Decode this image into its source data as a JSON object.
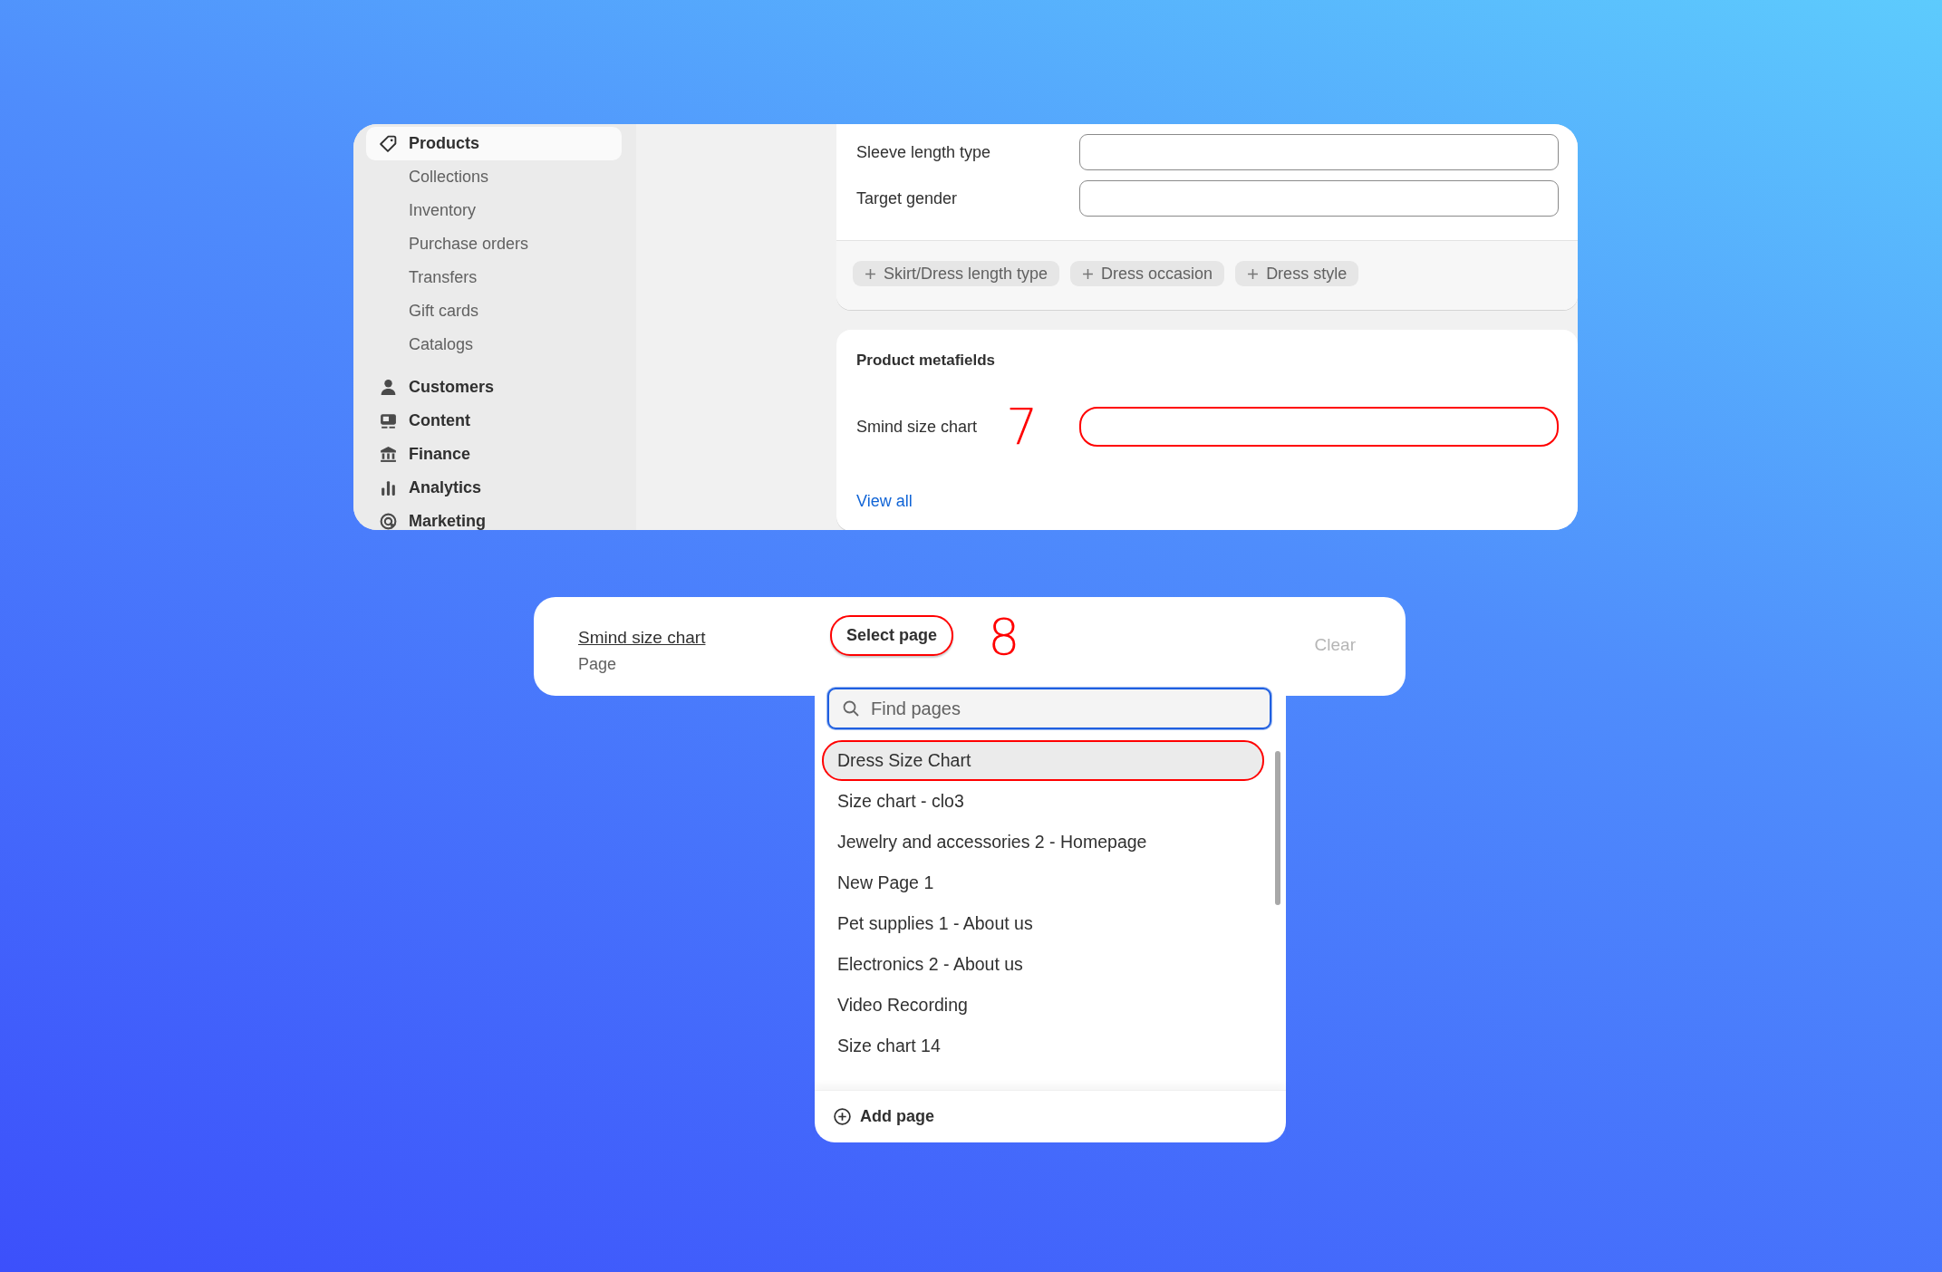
{
  "sidebar": {
    "items": [
      {
        "label": "Products",
        "selected": true,
        "children": [
          {
            "label": "Collections",
            "selected": false
          },
          {
            "label": "Inventory",
            "selected": false
          },
          {
            "label": "Purchase orders",
            "selected": false
          },
          {
            "label": "Transfers",
            "selected": false
          },
          {
            "label": "Gift cards",
            "selected": false
          },
          {
            "label": "Catalogs",
            "selected": false
          }
        ]
      },
      {
        "label": "Customers",
        "selected": false
      },
      {
        "label": "Content",
        "selected": false
      },
      {
        "label": "Finance",
        "selected": false
      },
      {
        "label": "Analytics",
        "selected": false
      },
      {
        "label": "Marketing",
        "selected": false
      }
    ]
  },
  "attributes_card": {
    "fields": [
      {
        "label": "Sleeve length type"
      },
      {
        "label": "Target gender"
      }
    ],
    "add_buttons": [
      "Skirt/Dress length type",
      "Dress occasion",
      "Dress style"
    ]
  },
  "metafields_card": {
    "title": "Product metafields",
    "fields": [
      {
        "label": "Smind size chart",
        "annotation": "7",
        "highlighted": true
      }
    ],
    "link": "View all"
  },
  "page_picker": {
    "name": "Smind size chart",
    "type": "Page",
    "button": "Select page",
    "button_highlighted": true,
    "annotation": "8",
    "clear": "Clear",
    "dropdown": {
      "search": {
        "placeholder": "Find pages"
      },
      "items": [
        {
          "label": "Dress Size Chart",
          "selected": true,
          "highlighted": true
        },
        {
          "label": "Size chart - clo3",
          "selected": false,
          "highlighted": false
        },
        {
          "label": "Jewelry and accessories 2 - Homepage",
          "selected": false,
          "highlighted": false
        },
        {
          "label": "New Page 1",
          "selected": false,
          "highlighted": false
        },
        {
          "label": "Pet supplies 1 - About us",
          "selected": false,
          "highlighted": false
        },
        {
          "label": "Electronics 2 - About us",
          "selected": false,
          "highlighted": false
        },
        {
          "label": "Video Recording",
          "selected": false,
          "highlighted": false
        },
        {
          "label": "Size chart 14",
          "selected": false,
          "highlighted": false
        }
      ],
      "footer": "Add page"
    }
  }
}
